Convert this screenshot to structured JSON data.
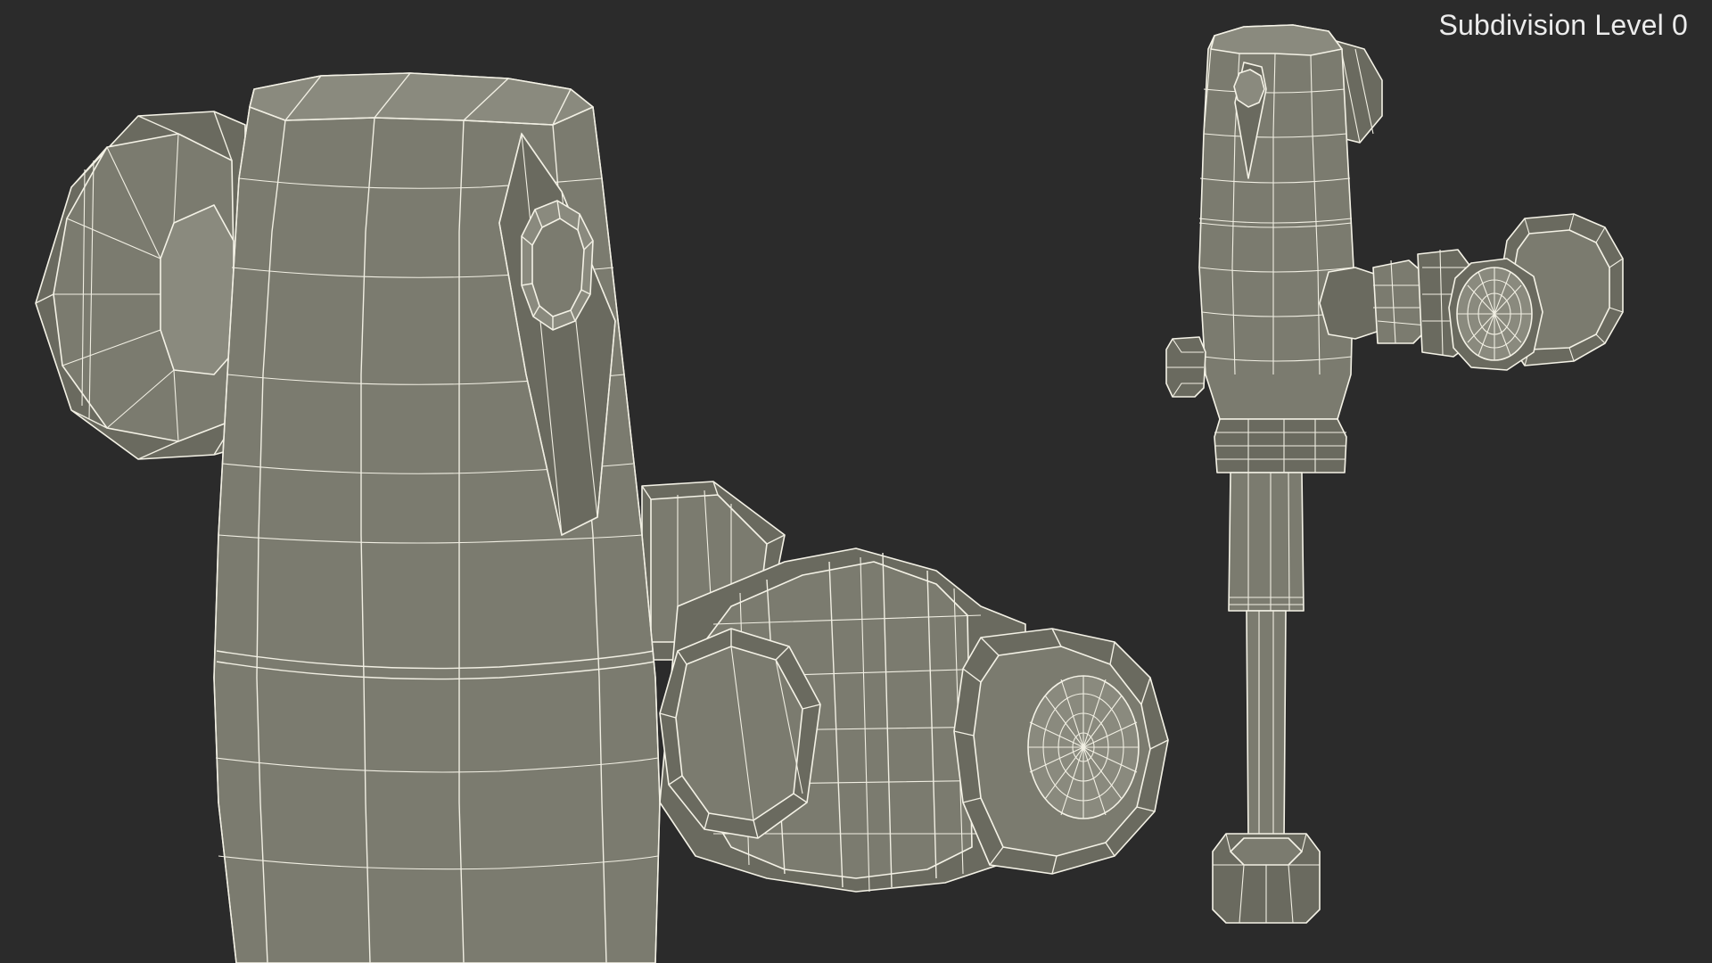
{
  "viewport": {
    "label": "Subdivision Level 0",
    "background_color": "#2b2b2b",
    "mesh_fill_color": "#7b7b6f",
    "wire_color": "#f4f2e6"
  }
}
